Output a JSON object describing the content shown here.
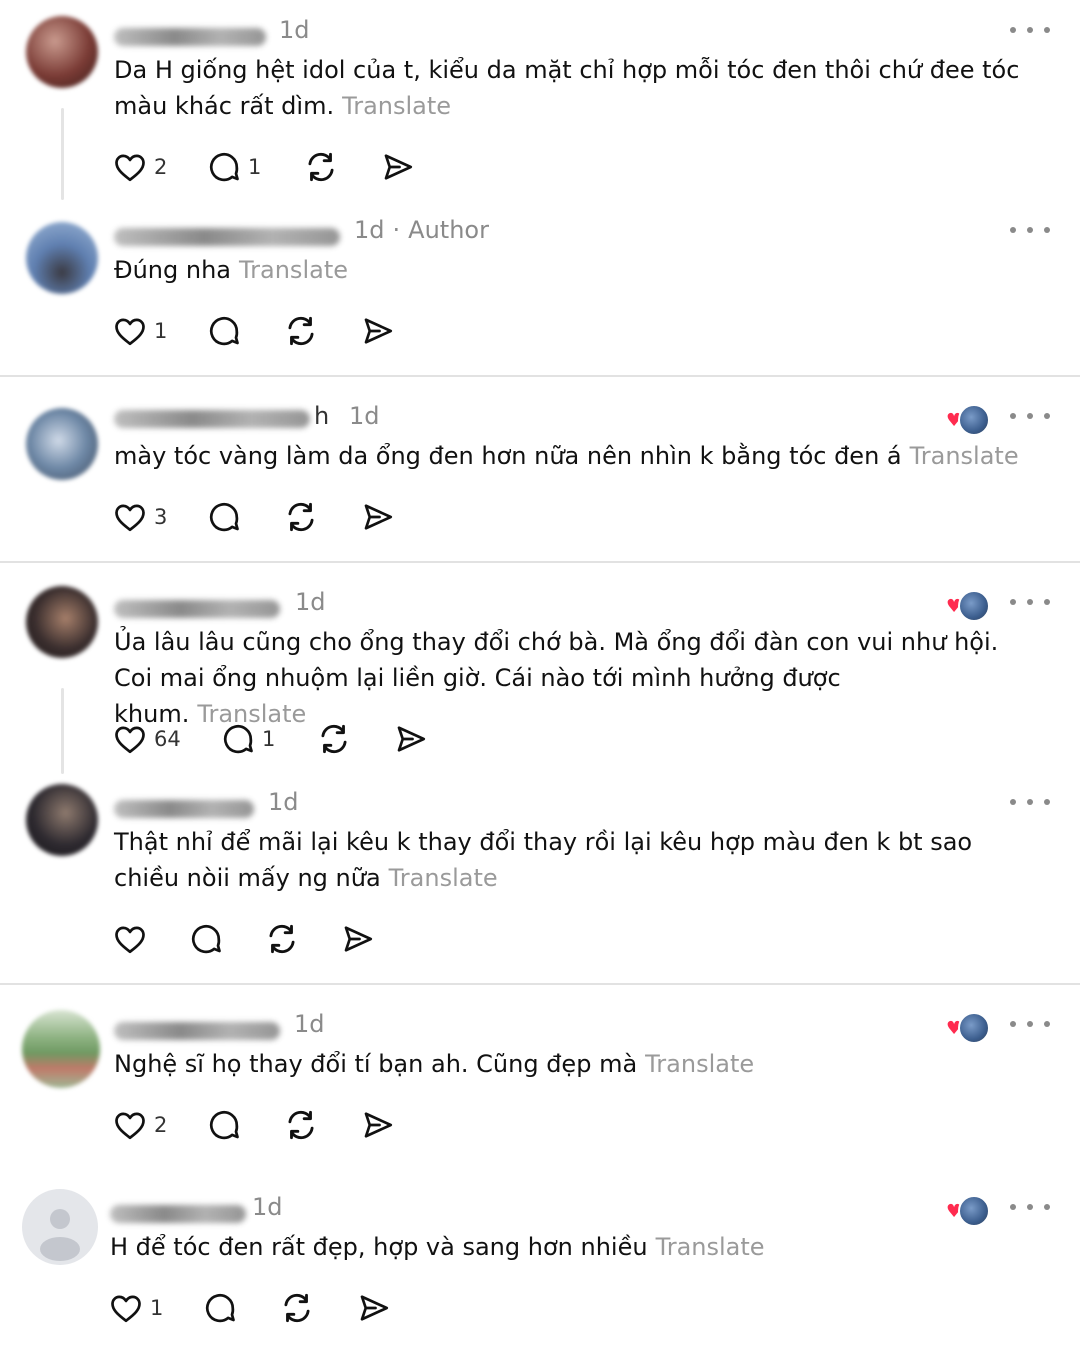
{
  "translate_label": "Translate",
  "comments": [
    {
      "time": "1d",
      "text": "Da H giống hệt idol của t, kiểu da mặt chỉ hợp mỗi tóc đen thôi chứ đee tóc màu khác rất dìm.",
      "likes": "2",
      "replies": "1",
      "avatar_color": "#7a3b35"
    },
    {
      "time": "1d",
      "author_label": "Author",
      "text": "Đúng nha",
      "likes": "1",
      "replies": "",
      "avatar_color": "#5f7fb0"
    },
    {
      "time": "1d",
      "username_visible_char": "h",
      "text": "mày tóc vàng làm da ổng đen hơn nữa nên nhìn k bằng tóc đen á",
      "likes": "3",
      "replies": "",
      "avatar_color": "#6e88a6",
      "author_reacted": true
    },
    {
      "time": "1d",
      "text": "Ủa lâu lâu cũng cho ổng thay đổi chớ bà. Mà ổng đổi đàn con vui như hội. Coi mai ổng nhuộm lại liền giờ. Cái nào tới mình hưởng được khum.",
      "likes": "64",
      "replies": "1",
      "avatar_color": "#3a2e2e",
      "author_reacted": true
    },
    {
      "time": "1d",
      "text": "Thật nhỉ để mãi lại kêu k thay đổi thay rồi lại kêu hợp màu đen k bt sao chiều nòii mấy ng nữa",
      "likes": "",
      "replies": "",
      "avatar_color": "#2e2a30"
    },
    {
      "time": "1d",
      "text": "Nghệ sĩ họ thay đổi tí bạn ah. Cũng đẹp mà",
      "likes": "2",
      "replies": "",
      "avatar_color": "#6f9a62",
      "author_reacted": true
    },
    {
      "time": "1d",
      "text": "H để tóc đen rất đẹp, hợp và sang hơn nhiều",
      "likes": "1",
      "replies": "",
      "avatar_color": "#c9ccd3",
      "author_reacted": true
    }
  ]
}
